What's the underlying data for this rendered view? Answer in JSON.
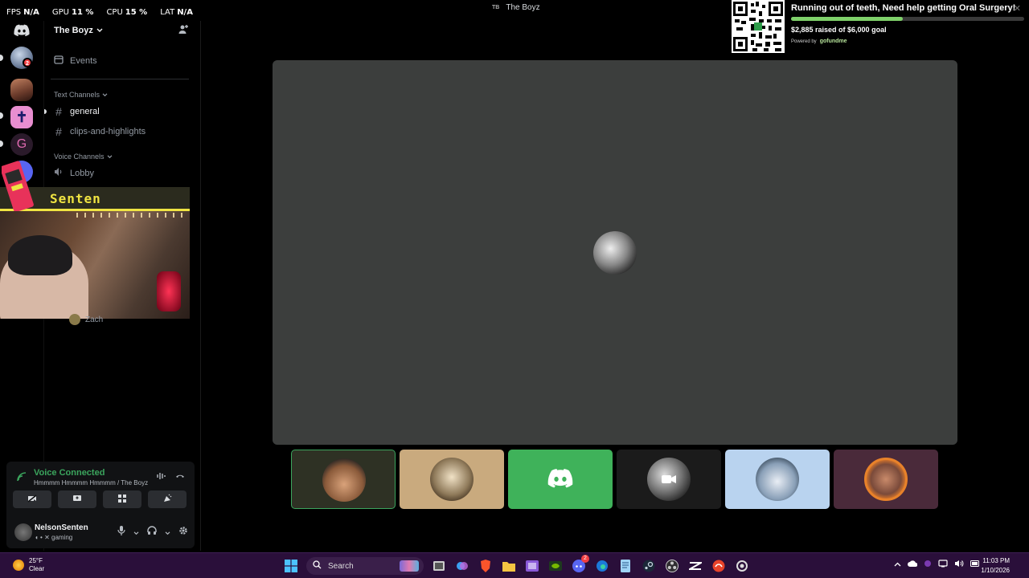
{
  "stats": [
    {
      "label": "FPS",
      "value": "N/A"
    },
    {
      "label": "GPU",
      "value": "11 %"
    },
    {
      "label": "CPU",
      "value": "15 %"
    },
    {
      "label": "LAT",
      "value": "N/A"
    }
  ],
  "window": {
    "icon_text": "TB",
    "title": "The Boyz"
  },
  "server": {
    "name": "The Boyz"
  },
  "rail": {
    "badge_count": "2"
  },
  "sidebar": {
    "events_label": "Events",
    "text_category": "Text Channels",
    "text_channels": [
      "general",
      "clips-and-highlights"
    ],
    "voice_category": "Voice Channels",
    "voice_channels": [
      "Lobby"
    ],
    "below_cam_user": "Zach"
  },
  "webcam": {
    "name": "Senten"
  },
  "voice": {
    "status": "Voice Connected",
    "location": "Hmmmm Hmmmm Hmmmm / The Boyz"
  },
  "user": {
    "name": "NelsonSenten",
    "status": "gaming"
  },
  "gofundme": {
    "title": "Running out of teeth, Need help getting Oral Surgery!",
    "raised_text": "$2,885 raised of $6,000 goal",
    "progress": 0.48,
    "powered_by": "Powered by",
    "brand": "gofundme"
  },
  "taskbar": {
    "temp": "25°F",
    "condition": "Clear",
    "search_label": "Search",
    "discord_badge": "2",
    "time": "11:03 PM",
    "date": "1/10/2026"
  },
  "colors": {
    "accent_green": "#3ba55d",
    "discord_blurple": "#5865f2",
    "tile_green": "#3fb25a"
  }
}
